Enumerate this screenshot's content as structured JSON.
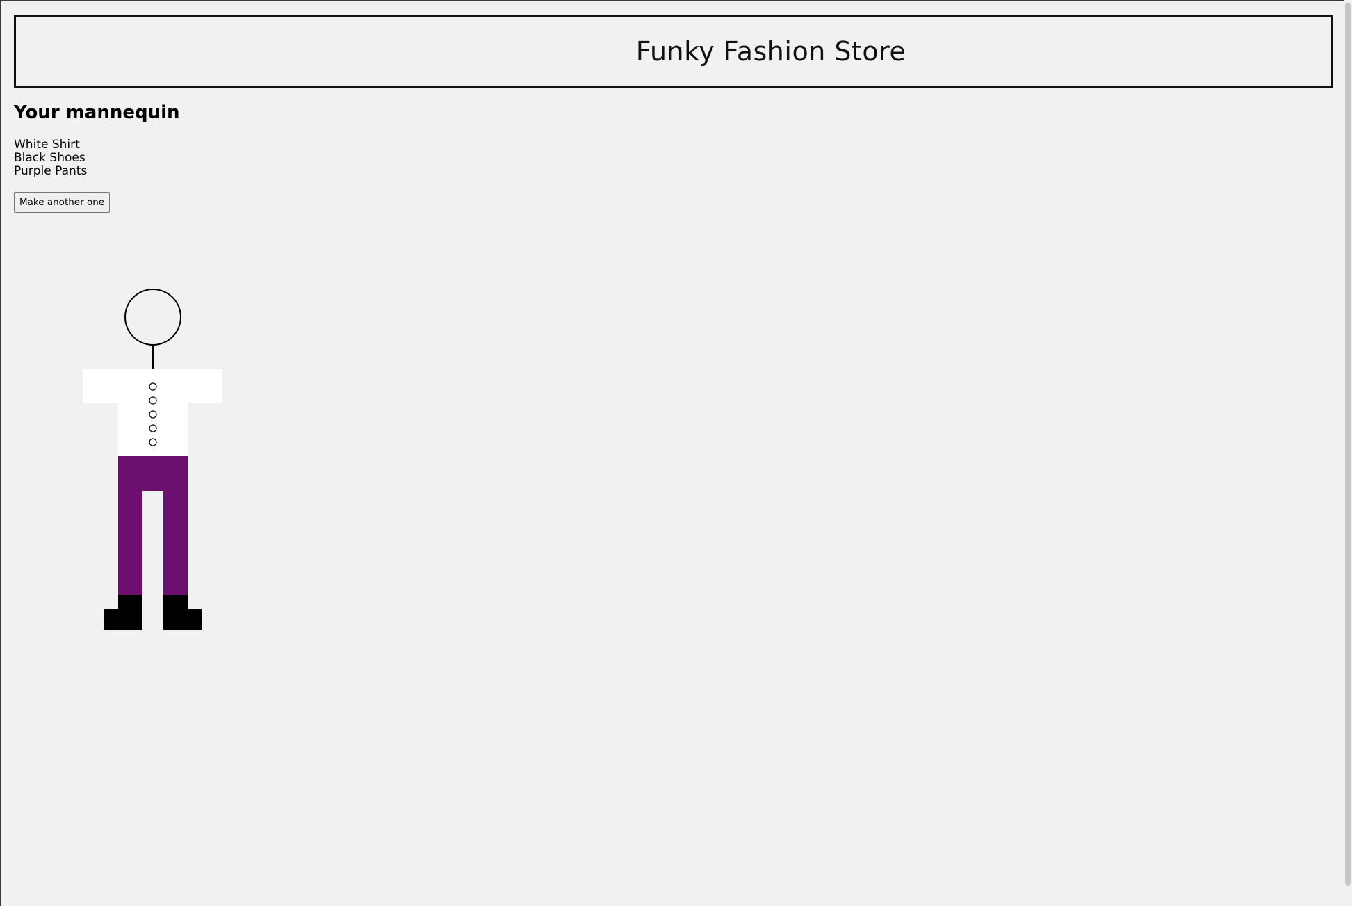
{
  "store": {
    "title": "Funky Fashion Store"
  },
  "mannequin_section": {
    "heading": "Your mannequin",
    "outfit_items": [
      "White Shirt",
      "Black Shoes",
      "Purple Pants"
    ],
    "remake_button_label": "Make another one"
  },
  "outfit_colors": {
    "shirt": "#ffffff",
    "pants": "#6d106d",
    "shoes": "#000000",
    "page_background": "#f1f1f1"
  },
  "shirt_button_count": 5
}
